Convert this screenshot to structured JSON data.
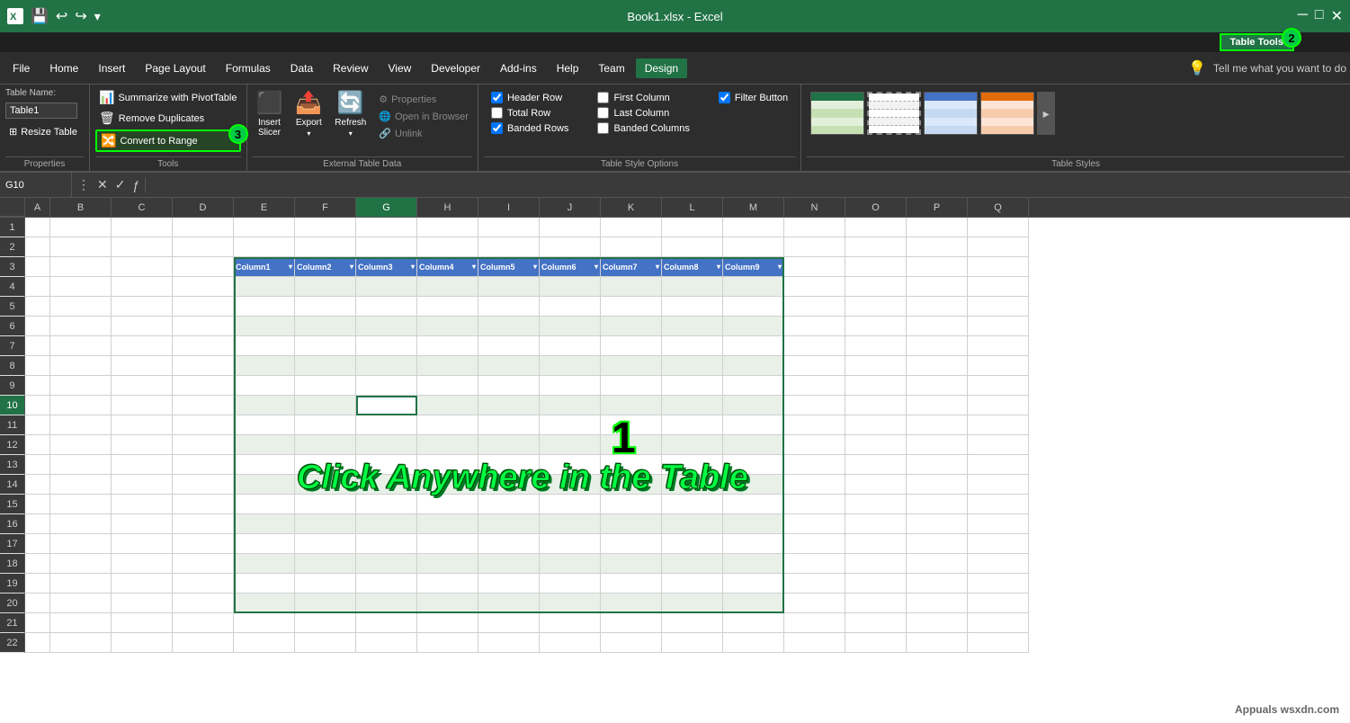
{
  "titleBar": {
    "title": "Book1.xlsx - Excel",
    "saveIcon": "💾",
    "undoIcon": "↩",
    "redoIcon": "↪"
  },
  "tableToolsBar": {
    "label": "Table Tools",
    "badge": "2"
  },
  "menuBar": {
    "items": [
      "File",
      "Home",
      "Insert",
      "Page Layout",
      "Formulas",
      "Data",
      "Review",
      "View",
      "Developer",
      "Add-ins",
      "Help",
      "Team",
      "Design"
    ],
    "activeItem": "Design",
    "tellMe": "Tell me what you want to do"
  },
  "ribbon": {
    "groups": [
      {
        "label": "Properties",
        "items": [
          {
            "type": "table-name",
            "label": "Table Name:",
            "value": "Table1"
          },
          {
            "type": "button-sm",
            "label": "Resize Table",
            "icon": "⊞"
          }
        ]
      },
      {
        "label": "Tools",
        "items": [
          {
            "type": "button-sm",
            "label": "Summarize with PivotTable",
            "icon": "📊"
          },
          {
            "type": "button-sm",
            "label": "Remove Duplicates",
            "icon": "🗑",
            "highlighted": false
          },
          {
            "type": "button-sm",
            "label": "Convert to Range",
            "icon": "🔀",
            "highlighted": true,
            "badge": "3"
          }
        ]
      },
      {
        "label": "",
        "items": [
          {
            "type": "button-lg",
            "label": "Insert Slicer",
            "icon": "⬛"
          },
          {
            "type": "button-lg",
            "label": "Export",
            "icon": "📤"
          },
          {
            "type": "button-lg",
            "label": "Refresh",
            "icon": "🔄"
          },
          {
            "type": "button-group",
            "label": "External Table Data",
            "items": [
              {
                "label": "Properties",
                "icon": "⚙",
                "disabled": true
              },
              {
                "label": "Open in Browser",
                "icon": "🌐",
                "disabled": true
              },
              {
                "label": "Unlink",
                "icon": "🔗",
                "disabled": true
              }
            ]
          }
        ]
      },
      {
        "label": "Table Style Options",
        "checkboxes": [
          {
            "label": "Header Row",
            "checked": true
          },
          {
            "label": "Total Row",
            "checked": false
          },
          {
            "label": "Banded Rows",
            "checked": true
          },
          {
            "label": "First Column",
            "checked": false
          },
          {
            "label": "Last Column",
            "checked": false
          },
          {
            "label": "Banded Columns",
            "checked": false
          },
          {
            "label": "Filter Button",
            "checked": true
          }
        ]
      }
    ],
    "tableStyles": {
      "label": "Table Styles",
      "styles": [
        {
          "colors": [
            "#e2efda",
            "#c6e0b4",
            "#e2efda",
            "#c6e0b4",
            "#e2efda"
          ]
        },
        {
          "colors": [
            "#ffffff",
            "#f2f2f2",
            "#ffffff",
            "#f2f2f2",
            "#ffffff"
          ],
          "dashed": true
        },
        {
          "colors": [
            "#dae8fc",
            "#c5d9f1",
            "#dae8fc",
            "#c5d9f1",
            "#dae8fc"
          ]
        },
        {
          "colors": [
            "#fce4d6",
            "#f8cbad",
            "#fce4d6",
            "#f8cbad",
            "#fce4d6"
          ]
        }
      ]
    }
  },
  "formulaBar": {
    "cellRef": "G10",
    "value": ""
  },
  "columns": [
    "A",
    "B",
    "C",
    "D",
    "E",
    "F",
    "G",
    "H",
    "I",
    "J",
    "K",
    "L",
    "M",
    "N",
    "O",
    "P",
    "Q"
  ],
  "tableColumns": [
    "Column1",
    "Column2",
    "Column3",
    "Column4",
    "Column5",
    "Column6",
    "Column7",
    "Column8",
    "Column9"
  ],
  "rows": [
    1,
    2,
    3,
    4,
    5,
    6,
    7,
    8,
    9,
    10,
    11,
    12,
    13,
    14,
    15,
    16,
    17,
    18,
    19,
    20,
    21,
    22
  ],
  "tableStartRow": 3,
  "tableEndRow": 21,
  "tableStartCol": 4,
  "tableEndCol": 12,
  "selectedCell": {
    "row": 10,
    "col": 7
  },
  "overlay": {
    "number": "1",
    "text": "Click Anywhere in the Table"
  },
  "watermark": "Appuals wsxdn.com"
}
